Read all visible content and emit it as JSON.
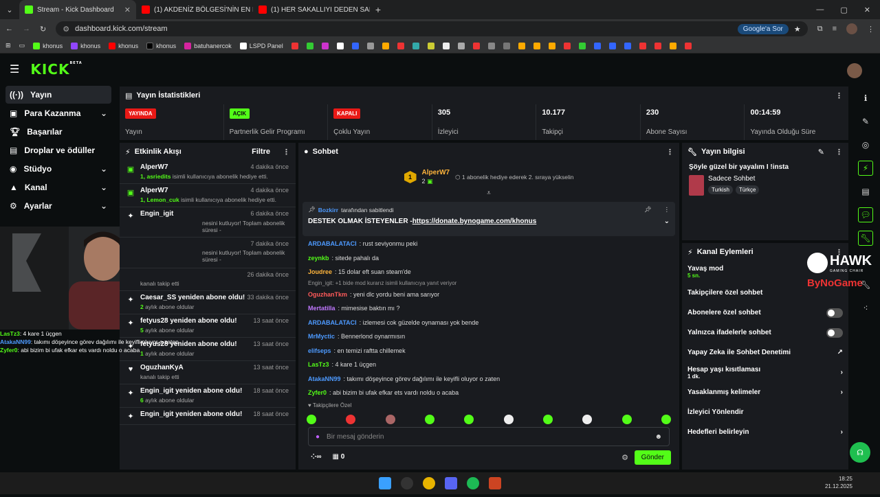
{
  "browser": {
    "tabs": [
      {
        "title": "Stream - Kick Dashboard",
        "active": true
      },
      {
        "title": "(1) AKDENİZ BÖLGESİ'NİN EN D",
        "active": false
      },
      {
        "title": "(1) HER SAKALLIYI DEDEN SAN",
        "active": false
      }
    ],
    "url": "dashboard.kick.com/stream",
    "google_btn": "Google'a Sor",
    "bookmarks": [
      "khonus",
      "khonus",
      "khonus",
      "khonus",
      "batuhanercok",
      "LSPD Panel"
    ]
  },
  "sidebar": {
    "items": [
      {
        "label": "Yayın",
        "icon": "broadcast-icon"
      },
      {
        "label": "Para Kazanma",
        "icon": "money-icon"
      },
      {
        "label": "Başarılar",
        "icon": "trophy-icon"
      },
      {
        "label": "Droplar ve ödüller",
        "icon": "gift-icon"
      },
      {
        "label": "Stüdyo",
        "icon": "studio-icon"
      },
      {
        "label": "Kanal",
        "icon": "channel-icon"
      },
      {
        "label": "Ayarlar",
        "icon": "gear-icon"
      }
    ]
  },
  "stats": {
    "title": "Yayın İstatistikleri",
    "cards": [
      {
        "badge": "YAYINDA",
        "label": "Yayın"
      },
      {
        "badge": "AÇIK",
        "label": "Partnerlik Gelir Programı"
      },
      {
        "badge": "KAPALI",
        "label": "Çoklu Yayın"
      },
      {
        "value": "305",
        "label": "İzleyici"
      },
      {
        "value": "10.177",
        "label": "Takipçi"
      },
      {
        "value": "230",
        "label": "Abone Sayısı"
      },
      {
        "value": "00:14:59",
        "label": "Yayında Olduğu Süre"
      }
    ]
  },
  "activity": {
    "title": "Etkinlik Akışı",
    "filter": "Filtre",
    "items": [
      {
        "name": "AlperW7",
        "time": "4 dakika önce",
        "count": "1,",
        "user": "asriedits",
        "desc": "isimli kullanıcıya abonelik hediye etti."
      },
      {
        "name": "AlperW7",
        "time": "4 dakika önce",
        "count": "1,",
        "user": "Lemon_cuk",
        "desc": "isimli kullanıcıya abonelik hediye etti."
      },
      {
        "name": "Engin_igit",
        "time": "6 dakika önce",
        "count": "",
        "user": "",
        "desc": "nesini kutluyor! Toplam abonelik süresi -"
      },
      {
        "name": "",
        "time": "7 dakika önce",
        "count": "",
        "user": "",
        "desc": "nesini kutluyor! Toplam abonelik süresi -"
      },
      {
        "name": "",
        "time": "26 dakika önce",
        "count": "",
        "user": "",
        "desc": "kanalı takip etti"
      },
      {
        "name": "Caesar_SS yeniden abone oldu!",
        "time": "33 dakika önce",
        "count": "2",
        "user": "",
        "desc": "aylık abone oldular"
      },
      {
        "name": "fetyus28 yeniden abone oldu!",
        "time": "13 saat önce",
        "count": "5",
        "user": "",
        "desc": "aylık abone oldular"
      },
      {
        "name": "fetyus28 yeniden abone oldu!",
        "time": "13 saat önce",
        "count": "1",
        "user": "",
        "desc": "aylık abone oldular"
      },
      {
        "name": "OguzhanKyA",
        "time": "13 saat önce",
        "count": "",
        "user": "",
        "desc": "kanalı takip etti"
      },
      {
        "name": "Engin_igit yeniden abone oldu!",
        "time": "18 saat önce",
        "count": "6",
        "user": "",
        "desc": "aylık abone oldular"
      },
      {
        "name": "Engin_igit yeniden abone oldu!",
        "time": "18 saat önce",
        "count": "",
        "user": "",
        "desc": ""
      }
    ]
  },
  "chat": {
    "title": "Sohbet",
    "hype_user": "AlperW7",
    "hype_count": "2",
    "hype_level": "1",
    "hype_text": "1 abonelik hediye ederek 2. sıraya yükselin",
    "pinned_by": "Bozkirr",
    "pinned_by_suffix": "tarafından sabitlendi",
    "pinned_text": "DESTEK OLMAK İSTEYENLER - ",
    "pinned_link": "https://donate.bynogame.com/khonus",
    "messages": [
      {
        "user": "ARDABALATACI",
        "color": "#4d9aff",
        "text": ": rust seviyonmu peki"
      },
      {
        "user": "zeynkb",
        "color": "#53fc18",
        "text": ": sitede pahalı da"
      },
      {
        "user": "Joudree",
        "color": "#ffb53c",
        "text": ": 15 dolar eft suan steam'de"
      },
      {
        "user": "OguzhanTkm",
        "color": "#ff5a5a",
        "text": ": yeni dlc yordu beni ama sarıyor",
        "reply": "Engin_igit: +1 bide mod kurarız isimli kullanıcıya yanıt veriyor"
      },
      {
        "user": "Mertatilla",
        "color": "#c078ff",
        "text": ": mimesise baktın mı ?"
      },
      {
        "user": "ARDABALATACI",
        "color": "#4d9aff",
        "text": ": izlemesi cok güzelde oynaması yok bende"
      },
      {
        "user": "MrMyctic",
        "color": "#4d9aff",
        "text": ": Bennerlond oynarmısın"
      },
      {
        "user": "elifseps",
        "color": "#4d9aff",
        "text": ": en temizi raftta chillemek"
      },
      {
        "user": "LasTz3",
        "color": "#53fc18",
        "text": ": 4 kare 1 üçgen"
      },
      {
        "user": "AtakaNN99",
        "color": "#4d9aff",
        "text": ": takımı döşeyince görev dağılımı ile keyifli oluyor o zaten"
      },
      {
        "user": "Zyfer0",
        "color": "#53fc18",
        "text": ": abi bizim bi ufak efkar ets vardı noldu o acaba"
      }
    ],
    "followers_only": "Takipçilere Özel",
    "input_placeholder": "Bir mesaj gönderin",
    "points": "0",
    "send_label": "Gönder"
  },
  "stream_info": {
    "title": "Yayın bilgisi",
    "stream_title": "Şöyle güzel bir yayalım I !insta",
    "category": "Sadece Sohbet",
    "tags": [
      "Turkish",
      "Türkçe"
    ]
  },
  "channel_actions": {
    "title": "Kanal Eylemleri",
    "slow_mode": "Yavaş mod",
    "slow_mode_value": "5 sn.",
    "items": [
      {
        "label": "Takipçilere özel sohbet",
        "kind": "toggle"
      },
      {
        "label": "Abonelere özel sohbet",
        "kind": "toggle"
      },
      {
        "label": "Yalnızca ifadelerle sohbet",
        "kind": "toggle"
      },
      {
        "label": "Yapay Zeka ile Sohbet Denetimi",
        "kind": "link"
      },
      {
        "label": "Hesap yaşı kısıtlaması",
        "kind": "chevron",
        "sub": "1 dk."
      },
      {
        "label": "Yasaklanmış kelimeler",
        "kind": "chevron"
      },
      {
        "label": "İzleyici Yönlendir",
        "kind": "none"
      },
      {
        "label": "Hedefleri belirleyin",
        "kind": "chevron"
      }
    ]
  },
  "overlay": {
    "lines": [
      {
        "user": "LasTz3",
        "text": ": 4 kare 1 üçgen"
      },
      {
        "user": "AtakaNN99",
        "text": ": takımı döşeyince görev dağılımı ile keyifli oluyor o zaten"
      },
      {
        "user": "Zyfer0",
        "text": ": abi bizim bi ufak efkar ets vardı noldu o acaba"
      }
    ],
    "brand1": "HAWK",
    "brand1_sub": "GAMING CHAIR",
    "brand2": "ByNoGame"
  },
  "clock": {
    "time": "18:25",
    "date": "21.12.2025"
  },
  "colors": {
    "accent": "#53fc18",
    "live": "#e91916",
    "bg": "#0b0e0f",
    "panel": "#191b1f"
  }
}
